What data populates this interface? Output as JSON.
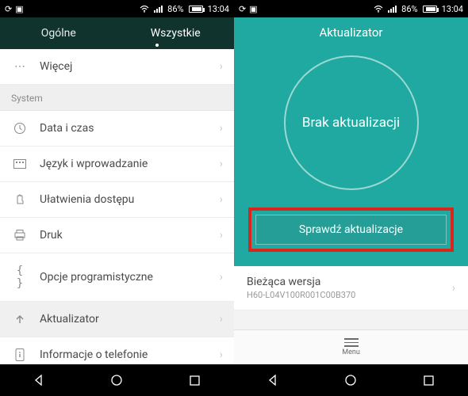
{
  "status": {
    "battery_pct": "86%",
    "time": "13:04"
  },
  "left": {
    "tabs": {
      "general": "Ogólne",
      "all": "Wszystkie"
    },
    "items": {
      "more": "Więcej",
      "system_header": "System",
      "date_time": "Data i czas",
      "lang_input": "Język i wprowadzanie",
      "accessibility": "Ułatwienia dostępu",
      "printing": "Druk",
      "dev_options": "Opcje programistyczne",
      "updater": "Aktualizator",
      "about_phone": "Informacje o telefonie"
    }
  },
  "right": {
    "title": "Aktualizator",
    "circle_text": "Brak aktualizacji",
    "check_button": "Sprawdź aktualizacje",
    "version_label": "Bieżąca wersja",
    "version_value": "H60-L04V100R001C00B370",
    "menu_label": "Menu"
  }
}
